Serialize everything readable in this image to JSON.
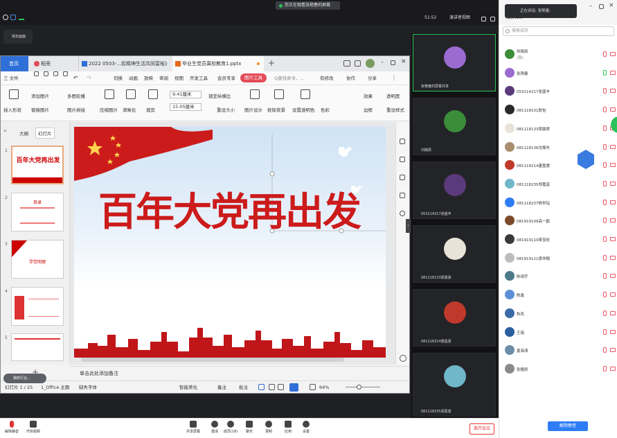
{
  "topbar": {
    "share_banner": "您正在观看张艳春的屏幕",
    "time": "51:52",
    "view_mode": "演讲者视图",
    "pin_label": "锁定画面"
  },
  "wps": {
    "tabs": [
      "首页",
      "稻壳",
      "2022 0503-...民精神生活共同富裕》",
      "毕业生党员离校教育1.pptx"
    ],
    "menu": [
      "三 文件",
      "切换",
      "动画",
      "放映",
      "审阅",
      "视图",
      "开发工具",
      "会员专享",
      "图片工具",
      "Q查找命令、...",
      "有修改",
      "协作",
      "分享"
    ],
    "ribbon": {
      "insert_shape": "插入形状",
      "add_picture": "添加图片",
      "multi_carousel": "多图轮播",
      "replace_picture": "替换图片",
      "picture_join": "图片拼接",
      "compress": "压缩图片",
      "clarify": "清晰化",
      "crop": "裁剪",
      "width": "9.41厘米",
      "height": "15.05厘米",
      "lock_ratio": "锁定纵横比",
      "reset_size": "重设大小",
      "picture_design": "图片设计",
      "remove_bg": "抠除背景",
      "set_transparent": "设置透明色",
      "color": "色彩",
      "effect": "效果",
      "transparency": "透明度",
      "border": "边框",
      "reset_style": "重设样式"
    },
    "panel_tabs": [
      "大纲",
      "幻灯片"
    ],
    "thumbs": [
      {
        "num": "1",
        "title": "百年大党再出发"
      },
      {
        "num": "2",
        "title": "目录"
      },
      {
        "num": "3",
        "title": "学党明理"
      },
      {
        "num": "4",
        "title": ""
      },
      {
        "num": "5",
        "title": ""
      }
    ],
    "slide_title": "百年大党再出发",
    "notes": "单击此处添加备注",
    "status": {
      "slide_count": "幻灯片 1 / 25",
      "theme": "1_Office 主题",
      "missing_font": "缺失字体",
      "smart_beautify": "智能美化",
      "notes": "备注",
      "comments": "批注",
      "zoom": "64%",
      "activity": "我的行业..."
    }
  },
  "videos": [
    {
      "name": "张艳春的屏幕共享",
      "avatar": "#9b6bd1"
    },
    {
      "name": "刘婉辰",
      "avatar": "#3c8d3a"
    },
    {
      "name": "053114217张盛丰",
      "avatar": "#5a3a7a"
    },
    {
      "name": "081118133梁骏骄",
      "avatar": "#e9e2d8"
    },
    {
      "name": "081118214唐盈雯",
      "avatar": "#c0392b"
    },
    {
      "name": "081118235郑嘉富",
      "avatar": "#6fb7c9"
    }
  ],
  "participants_panel": {
    "speaking": "正在讲话: 张艳春;",
    "members": "成员(18)",
    "search_placeholder": "搜索成员",
    "unmute_all": "解除静音",
    "members_list": [
      {
        "name": "刘婉辰",
        "sub": "(我)",
        "avatar": "#3c8d3a"
      },
      {
        "name": "张艳春",
        "sub": "",
        "avatar": "#9b6bd1"
      },
      {
        "name": "053114217张盛丰",
        "sub": "",
        "avatar": "#5a3a7a"
      },
      {
        "name": "081118101耿怡",
        "sub": "",
        "avatar": "#2a2a2a"
      },
      {
        "name": "081118133梁骏骄",
        "sub": "",
        "avatar": "#e9e2d8"
      },
      {
        "name": "081118136沈振东",
        "sub": "",
        "avatar": "#a88e6e"
      },
      {
        "name": "081118214唐盈雯",
        "sub": "",
        "avatar": "#c0392b"
      },
      {
        "name": "081118235郑嘉富",
        "sub": "",
        "avatar": "#6fb7c9"
      },
      {
        "name": "081118237杨世钻",
        "sub": "",
        "avatar": "#2f7df6"
      },
      {
        "name": "081919109高一鹤",
        "sub": "",
        "avatar": "#7a4a2a"
      },
      {
        "name": "081919110蒋宝屹",
        "sub": "",
        "avatar": "#3a3a3a"
      },
      {
        "name": "081919121梁伴翰",
        "sub": "",
        "avatar": "#bdbdbd"
      },
      {
        "name": "陈翊宇",
        "sub": "",
        "avatar": "#4d7a8a"
      },
      {
        "name": "陈鑫",
        "sub": "",
        "avatar": "#5a8fd8"
      },
      {
        "name": "秋风",
        "sub": "",
        "avatar": "#3b6aa8"
      },
      {
        "name": "王瑶",
        "sub": "",
        "avatar": "#2b5fa0"
      },
      {
        "name": "夏海涛",
        "sub": "",
        "avatar": "#6b8fa8"
      },
      {
        "name": "张檀原",
        "sub": "",
        "avatar": "#8a8a8a"
      }
    ]
  },
  "bottom_toolbar": {
    "mic": "解除静音",
    "camera": "开启视频",
    "share": "共享屏幕",
    "invite": "邀请",
    "members": "成员(18)",
    "chat": "聊天",
    "record": "录制",
    "apps": "应用",
    "settings": "设置",
    "leave": "离开会议"
  }
}
